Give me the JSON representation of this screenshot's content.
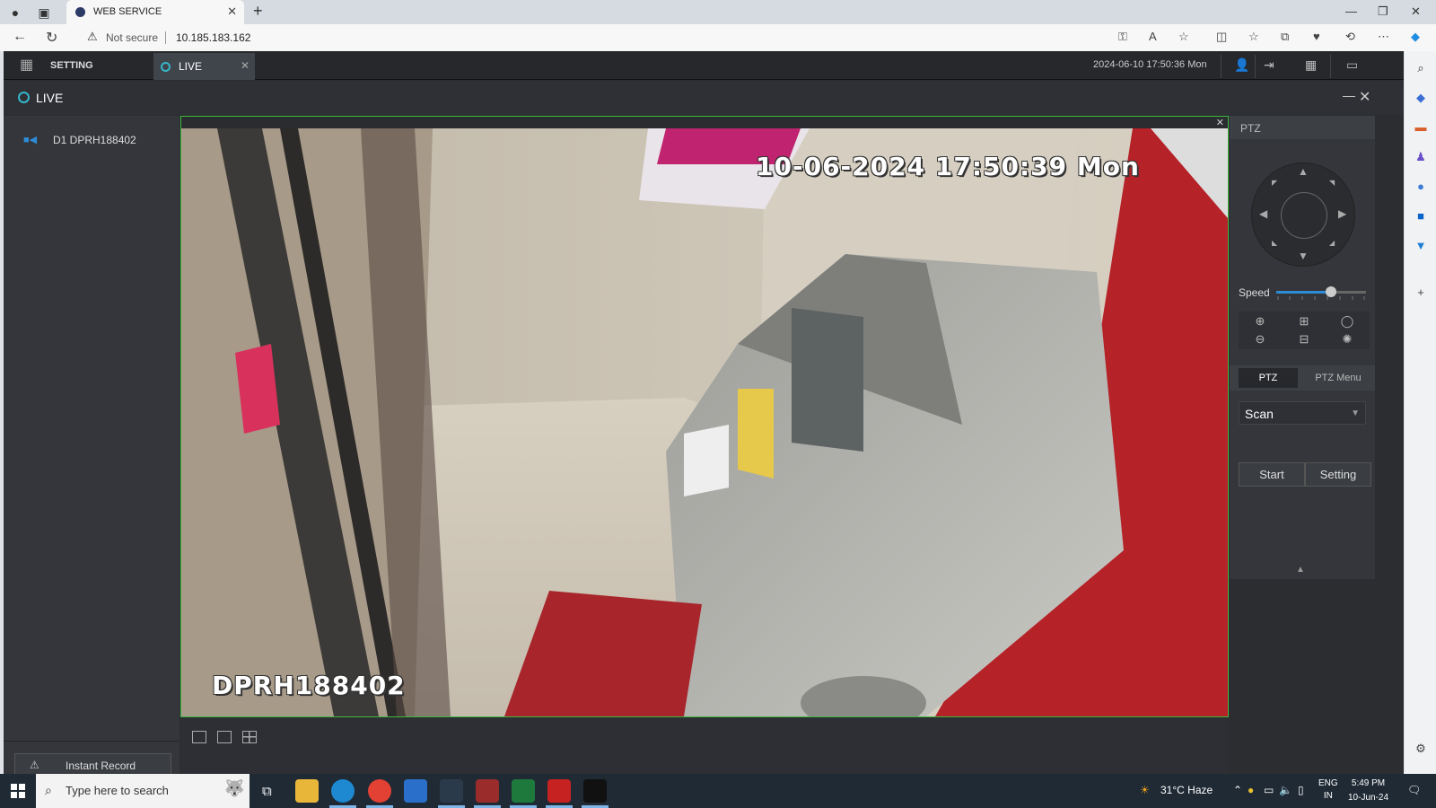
{
  "browser": {
    "tab_title": "WEB SERVICE",
    "security": "Not secure",
    "url": "10.185.183.162"
  },
  "app": {
    "setting_label": "SETTING",
    "live_tab_label": "LIVE",
    "datetime": "2024-06-10 17:50:36 Mon",
    "window_title": "LIVE"
  },
  "devices": [
    {
      "label": "D1 DPRH188402"
    }
  ],
  "left_panel": {
    "record_button": "Instant Record"
  },
  "video": {
    "osd_timestamp": "10-06-2024 17:50:39 Mon",
    "osd_channel": "DPRH188402"
  },
  "ptz": {
    "title": "PTZ",
    "speed_label": "Speed",
    "speed_level": 5,
    "speed_max": 8,
    "tab_ptz": "PTZ",
    "tab_menu": "PTZ Menu",
    "mode_selected": "Scan",
    "start_button": "Start",
    "setting_button": "Setting"
  },
  "taskbar": {
    "search_placeholder": "Type here to search",
    "weather": "31°C  Haze",
    "lang_top": "ENG",
    "lang_bottom": "IN",
    "time": "5:49 PM",
    "date": "10-Jun-24"
  },
  "colors": {
    "accent": "#35b6c9",
    "video_border": "#3fb83f",
    "camera_icon": "#2e8bd6"
  }
}
